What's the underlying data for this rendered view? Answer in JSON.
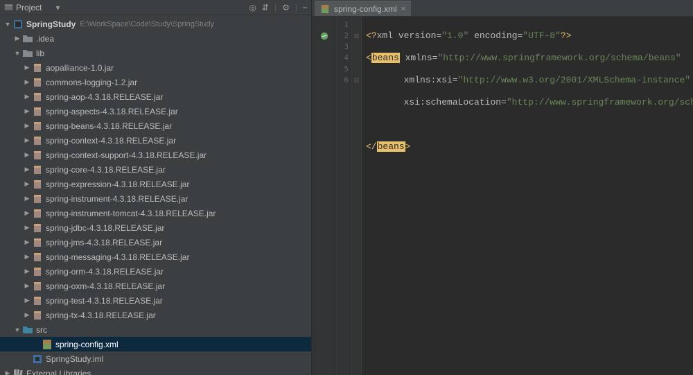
{
  "panel": {
    "title": "Project"
  },
  "toolbar": {
    "target": "◎",
    "collapse": "⇵",
    "gear": "⚙",
    "hide": "⎯"
  },
  "project": {
    "name": "SpringStudy",
    "path": "E:\\WorkSpace\\Code\\Study\\SpringStudy"
  },
  "tree": {
    "idea": ".idea",
    "lib": "lib",
    "libItems": [
      "aopalliance-1.0.jar",
      "commons-logging-1.2.jar",
      "spring-aop-4.3.18.RELEASE.jar",
      "spring-aspects-4.3.18.RELEASE.jar",
      "spring-beans-4.3.18.RELEASE.jar",
      "spring-context-4.3.18.RELEASE.jar",
      "spring-context-support-4.3.18.RELEASE.jar",
      "spring-core-4.3.18.RELEASE.jar",
      "spring-expression-4.3.18.RELEASE.jar",
      "spring-instrument-4.3.18.RELEASE.jar",
      "spring-instrument-tomcat-4.3.18.RELEASE.jar",
      "spring-jdbc-4.3.18.RELEASE.jar",
      "spring-jms-4.3.18.RELEASE.jar",
      "spring-messaging-4.3.18.RELEASE.jar",
      "spring-orm-4.3.18.RELEASE.jar",
      "spring-oxm-4.3.18.RELEASE.jar",
      "spring-test-4.3.18.RELEASE.jar",
      "spring-tx-4.3.18.RELEASE.jar"
    ],
    "src": "src",
    "srcFile": "spring-config.xml",
    "iml": "SpringStudy.iml",
    "extLibs": "External Libraries"
  },
  "editor": {
    "tab": "spring-config.xml",
    "lines": [
      "1",
      "2",
      "3",
      "4",
      "5",
      "6"
    ],
    "code": {
      "l1a": "<?",
      "l1b": "xml version",
      "l1c": "=",
      "l1s1": "\"1.0\"",
      "l1d": " encoding",
      "l1e": "=",
      "l1s2": "\"UTF-8\"",
      "l1f": "?>",
      "l2a": "<",
      "l2tag": "beans",
      "l2b": " xmlns",
      "l2c": "=",
      "l2s": "\"http://www.springframework.org/schema/beans\"",
      "l3a": "       xmlns:xsi",
      "l3b": "=",
      "l3s": "\"http://www.w3.org/2001/XMLSchema-instance\"",
      "l4a": "       xsi",
      "l4b": ":",
      "l4c": "schemaLocation",
      "l4d": "=",
      "l4s": "\"http://www.springframework.org/schem",
      "l5": "",
      "l6a": "</",
      "l6tag": "beans",
      "l6b": ">"
    }
  }
}
